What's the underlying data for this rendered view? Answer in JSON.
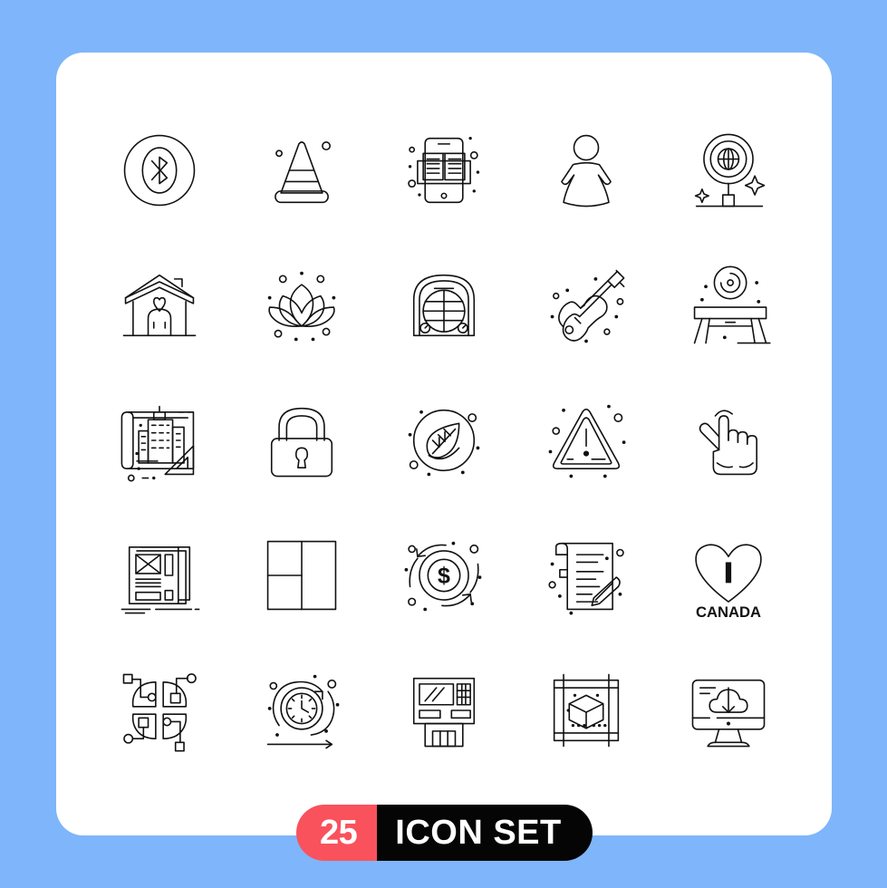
{
  "page": {
    "background_color": "#7FB5FA",
    "card_color": "#FFFFFF"
  },
  "badge": {
    "count": "25",
    "label": "ICON SET",
    "count_bg": "#F9525C",
    "label_bg": "#050505",
    "text_color": "#FFFFFF"
  },
  "icon_grid": {
    "columns": 5,
    "rows": 5,
    "total": 25,
    "stroke_color": "#111111",
    "items": [
      {
        "index": 1,
        "name": "bluetooth-circle-icon",
        "label": "Bluetooth"
      },
      {
        "index": 2,
        "name": "traffic-cone-icon",
        "label": "Traffic Cone"
      },
      {
        "index": 3,
        "name": "mobile-ebook-icon",
        "label": "Ebook"
      },
      {
        "index": 4,
        "name": "woman-figure-icon",
        "label": "Woman"
      },
      {
        "index": 5,
        "name": "globe-signboard-icon",
        "label": "Global Sign"
      },
      {
        "index": 6,
        "name": "home-heart-icon",
        "label": "Home"
      },
      {
        "index": 7,
        "name": "lotus-flower-icon",
        "label": "Lotus"
      },
      {
        "index": 8,
        "name": "fan-heater-icon",
        "label": "Heater"
      },
      {
        "index": 9,
        "name": "electric-guitar-icon",
        "label": "Guitar"
      },
      {
        "index": 10,
        "name": "table-clock-icon",
        "label": "Table"
      },
      {
        "index": 11,
        "name": "blueprint-building-icon",
        "label": "Blueprint"
      },
      {
        "index": 12,
        "name": "padlock-icon",
        "label": "Lock"
      },
      {
        "index": 13,
        "name": "eco-leaf-circle-icon",
        "label": "Eco"
      },
      {
        "index": 14,
        "name": "warning-triangle-icon",
        "label": "Warning"
      },
      {
        "index": 15,
        "name": "hand-tap-click-icon",
        "label": "Click"
      },
      {
        "index": 16,
        "name": "newspaper-icon",
        "label": "Newspaper"
      },
      {
        "index": 17,
        "name": "layout-grid-icon",
        "label": "Layout"
      },
      {
        "index": 18,
        "name": "dollar-transfer-icon",
        "label": "Money Transfer"
      },
      {
        "index": 19,
        "name": "contract-signature-icon",
        "label": "Contract"
      },
      {
        "index": 20,
        "name": "i-love-canada-icon",
        "label": "I CANADA"
      },
      {
        "index": 21,
        "name": "pie-network-icon",
        "label": "Data Network"
      },
      {
        "index": 22,
        "name": "clock-agile-icon",
        "label": "Agile Time"
      },
      {
        "index": 23,
        "name": "atm-machine-icon",
        "label": "ATM"
      },
      {
        "index": 24,
        "name": "cube-frame-icon",
        "label": "3D Cube"
      },
      {
        "index": 25,
        "name": "monitor-cloud-download-icon",
        "label": "Cloud Download"
      }
    ]
  },
  "canada_icon": {
    "letter": "I",
    "country": "CANADA"
  },
  "dollar_icon": {
    "symbol": "$"
  }
}
